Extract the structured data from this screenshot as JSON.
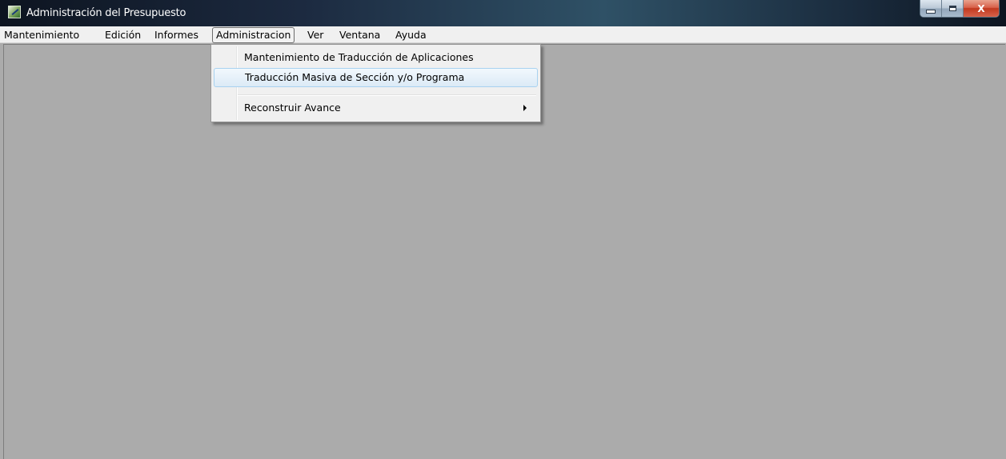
{
  "window": {
    "title": "Administración del Presupuesto",
    "app_icon": "app-edit-icon",
    "controls": {
      "minimize": "minimize-icon",
      "maximize": "restore-icon",
      "close_label": "X"
    }
  },
  "menubar": {
    "items": [
      {
        "label": "Mantenimiento"
      },
      {
        "label": "Edición"
      },
      {
        "label": "Informes"
      },
      {
        "label": "Administracion",
        "active": true
      },
      {
        "label": "Ver"
      },
      {
        "label": "Ventana"
      },
      {
        "label": "Ayuda"
      }
    ]
  },
  "dropdown": {
    "items": [
      {
        "label": "Mantenimiento de Traducción de Aplicaciones"
      },
      {
        "label": "Traducción Masiva de Sección y/o Programa",
        "highlighted": true
      },
      {
        "label": "Reconstruir Avance",
        "has_submenu": true
      }
    ],
    "submenu_icon": "chevron-right-icon"
  },
  "colors": {
    "client_background": "#ababab",
    "menubar_background": "#f0f0f0",
    "highlight_border": "#a8d2f0"
  }
}
